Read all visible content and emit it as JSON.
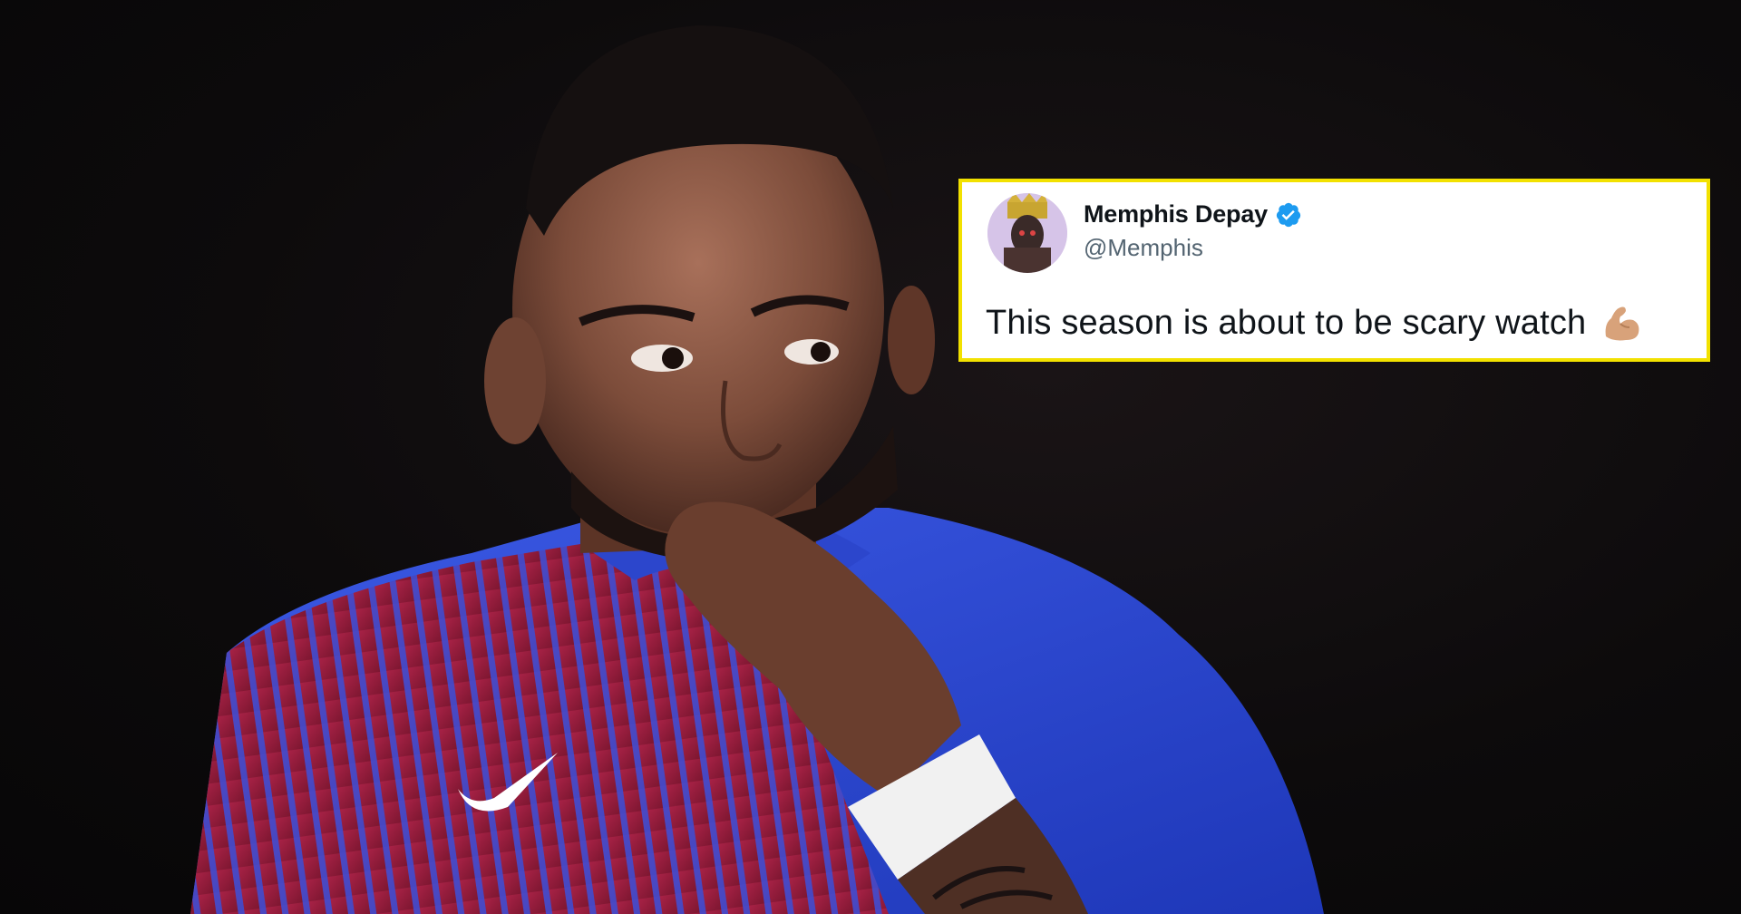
{
  "tweet": {
    "display_name": "Memphis Depay",
    "handle": "@Memphis",
    "text": "This season is about to be scary watch",
    "verified": true,
    "emoji": "flexed-biceps-icon"
  },
  "colors": {
    "card_border": "#f2e100",
    "verified_blue": "#1d9bf0",
    "jersey_blue": "#2f4fd6",
    "jersey_garnet": "#9b1c3c"
  }
}
